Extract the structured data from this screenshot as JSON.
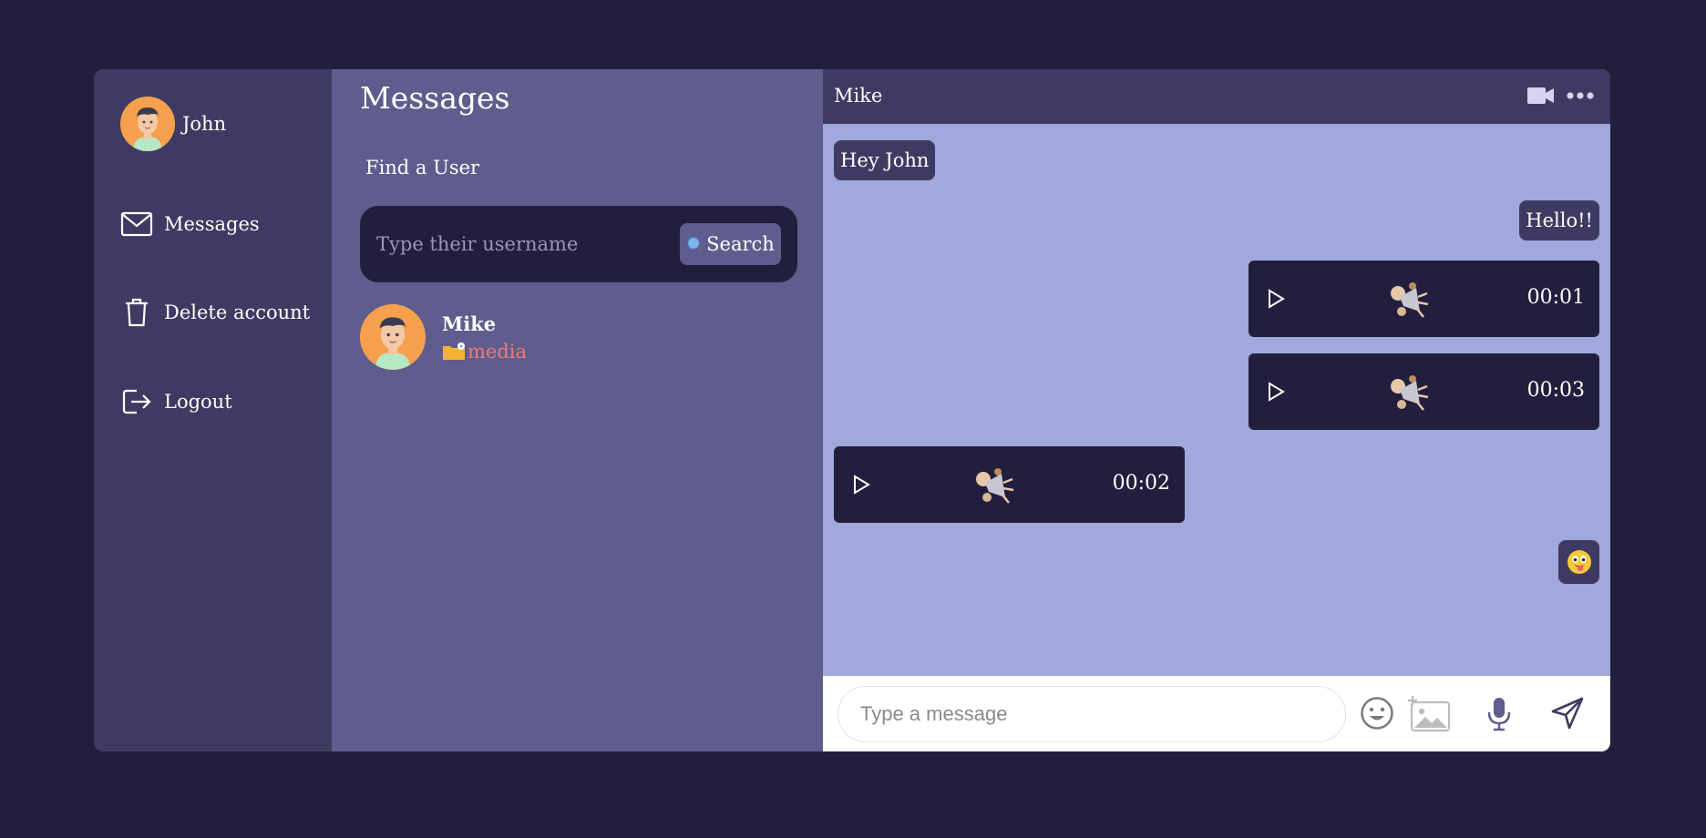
{
  "user": {
    "name": "John"
  },
  "sidebar": {
    "items": [
      {
        "label": "Messages",
        "icon": "mail-icon"
      },
      {
        "label": "Delete account",
        "icon": "trash-icon"
      },
      {
        "label": "Logout",
        "icon": "logout-icon"
      }
    ]
  },
  "messages_panel": {
    "title": "Messages",
    "find_label": "Find a User",
    "search": {
      "placeholder": "Type their username",
      "button_label": "Search"
    },
    "contacts": [
      {
        "name": "Mike",
        "preview": "media",
        "preview_icon": "folder-icon"
      }
    ]
  },
  "chat": {
    "title": "Mike",
    "messages": [
      {
        "type": "text",
        "direction": "incoming",
        "text": "Hey John"
      },
      {
        "type": "text",
        "direction": "outgoing",
        "text": "Hello!!"
      },
      {
        "type": "audio",
        "direction": "outgoing",
        "duration": "00:01"
      },
      {
        "type": "audio",
        "direction": "outgoing",
        "duration": "00:03"
      },
      {
        "type": "audio",
        "direction": "incoming",
        "duration": "00:02"
      },
      {
        "type": "emoji",
        "direction": "outgoing",
        "emoji": "😜"
      }
    ],
    "composer": {
      "placeholder": "Type a message"
    }
  },
  "colors": {
    "background": "#221e3d",
    "sidebar": "#3e3a61",
    "messages_panel": "#5e5d8d",
    "chat_background": "#a0a8dc",
    "bubble": "#3e3a61",
    "audio_bubble": "#221e3d",
    "preview_text": "#f07a7a",
    "avatar": "#f6a04d"
  }
}
